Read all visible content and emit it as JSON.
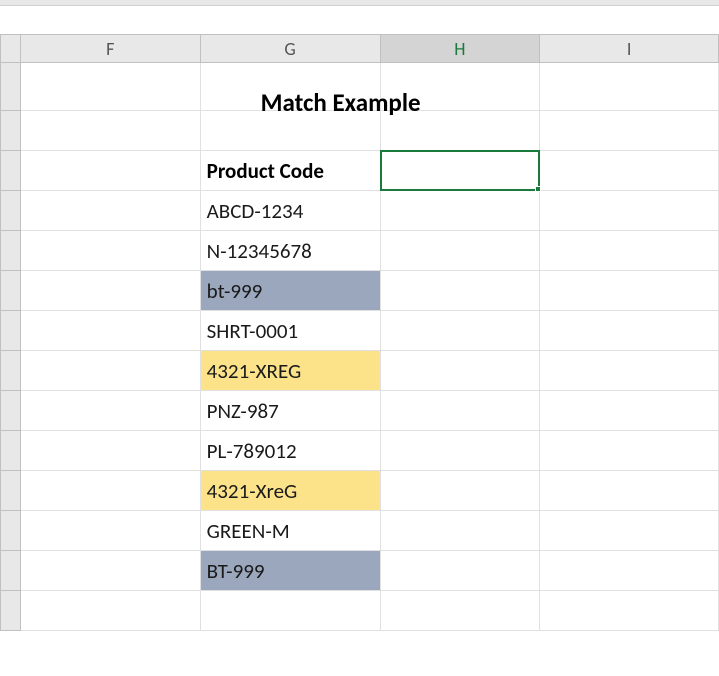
{
  "columns": {
    "F": "F",
    "G": "G",
    "H": "H",
    "I": "I"
  },
  "title": "Match Example",
  "header": "Product Code",
  "rows": [
    {
      "value": "ABCD-1234",
      "highlight": ""
    },
    {
      "value": "N-12345678",
      "highlight": ""
    },
    {
      "value": "bt-999",
      "highlight": "blue"
    },
    {
      "value": "SHRT-0001",
      "highlight": ""
    },
    {
      "value": "4321-XREG",
      "highlight": "yellow"
    },
    {
      "value": "PNZ-987",
      "highlight": ""
    },
    {
      "value": "PL-789012",
      "highlight": ""
    },
    {
      "value": "4321-XreG",
      "highlight": "yellow"
    },
    {
      "value": "GREEN-M",
      "highlight": ""
    },
    {
      "value": "BT-999",
      "highlight": "blue"
    }
  ],
  "selected_cell": "H3"
}
